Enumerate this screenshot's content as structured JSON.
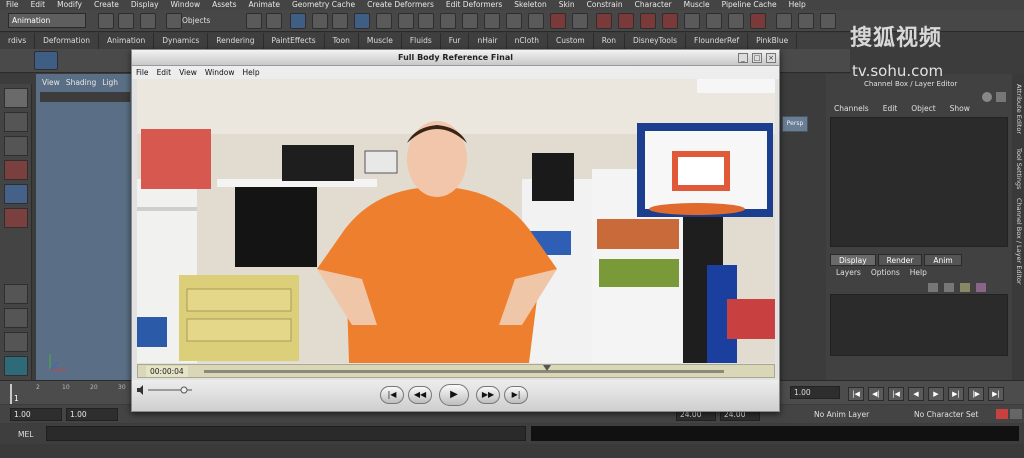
{
  "menubar": [
    "File",
    "Edit",
    "Modify",
    "Create",
    "Display",
    "Window",
    "Assets",
    "Animate",
    "Geometry Cache",
    "Create Deformers",
    "Edit Deformers",
    "Skeleton",
    "Skin",
    "Constrain",
    "Character",
    "Muscle",
    "Pipeline Cache",
    "Help"
  ],
  "statusline": {
    "mode": "Animation",
    "selection_label": "Objects"
  },
  "shelf_tabs": [
    "rdivs",
    "Deformation",
    "Animation",
    "Dynamics",
    "Rendering",
    "PaintEffects",
    "Toon",
    "Muscle",
    "Fluids",
    "Fur",
    "nHair",
    "nCloth",
    "Custom",
    "Ron",
    "DisneyTools",
    "FlounderRef",
    "PinkBlue"
  ],
  "viewport_menu": [
    "View",
    "Shading",
    "Ligh"
  ],
  "channel_box": {
    "title": "Channel Box / Layer Editor",
    "menu": [
      "Channels",
      "Edit",
      "Object",
      "Show"
    ]
  },
  "layer_editor": {
    "tabs": [
      "Display",
      "Render",
      "Anim"
    ],
    "menu": [
      "Layers",
      "Options",
      "Help"
    ]
  },
  "side_tabs": [
    "Attribute Editor",
    "Tool Settings",
    "Channel Box / Layer Editor"
  ],
  "time_slider": {
    "ticks": [
      "1",
      "2",
      "10",
      "20",
      "30",
      "40",
      "50",
      "60",
      "70",
      "80"
    ],
    "current_frame": "1.00"
  },
  "range_slider": {
    "start": "1.00",
    "playback_start": "1.00",
    "playback_end": "24.00",
    "end": "24.00",
    "anim_layer": "No Anim Layer",
    "character_set": "No Character Set"
  },
  "command_line": {
    "label": "MEL"
  },
  "watermark": {
    "main": "搜狐视频",
    "url": "tv.sohu.com"
  },
  "player": {
    "title": "Full Body Reference Final",
    "menu": [
      "File",
      "Edit",
      "View",
      "Window",
      "Help"
    ],
    "timecode": "00:00:04",
    "window_controls": [
      "_",
      "□",
      "×"
    ],
    "buttons": {
      "start": "|◀",
      "rewind": "◀◀",
      "play": "▶",
      "forward": "▶▶",
      "end": "▶|"
    }
  },
  "viewport_button": "Persp"
}
